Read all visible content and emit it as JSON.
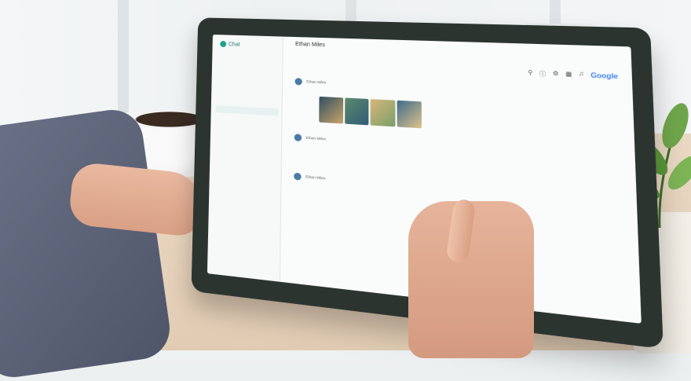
{
  "scene": {
    "colors": {
      "desk": "#e7d3bc",
      "tablet_bezel": "#2c3430",
      "sleeve": "#5f667a",
      "accent": "#1aa38a"
    }
  },
  "screen": {
    "app": {
      "title": "Chat"
    },
    "sidebar": {
      "items": [
        "",
        "",
        "",
        "",
        "",
        "",
        "",
        "",
        "",
        "",
        "",
        "",
        "",
        "",
        "",
        "",
        "",
        "",
        "",
        ""
      ]
    },
    "header": {
      "contact_name": "Ethan Miles"
    },
    "toolbar": {
      "icons": [
        "search-icon",
        "help-icon",
        "settings-icon",
        "apps-icon",
        "bell-icon"
      ],
      "brand": "Google"
    },
    "messages": [
      {
        "author": "Ethan Miles",
        "text": "",
        "has_photos": true
      },
      {
        "author": "Ethan Miles",
        "text": ""
      },
      {
        "author": "Ethan Miles",
        "text": ""
      }
    ],
    "photos": [
      "#3f6f7f",
      "#5c7f4a",
      "#c2a06b",
      "#2f5c7a"
    ]
  }
}
